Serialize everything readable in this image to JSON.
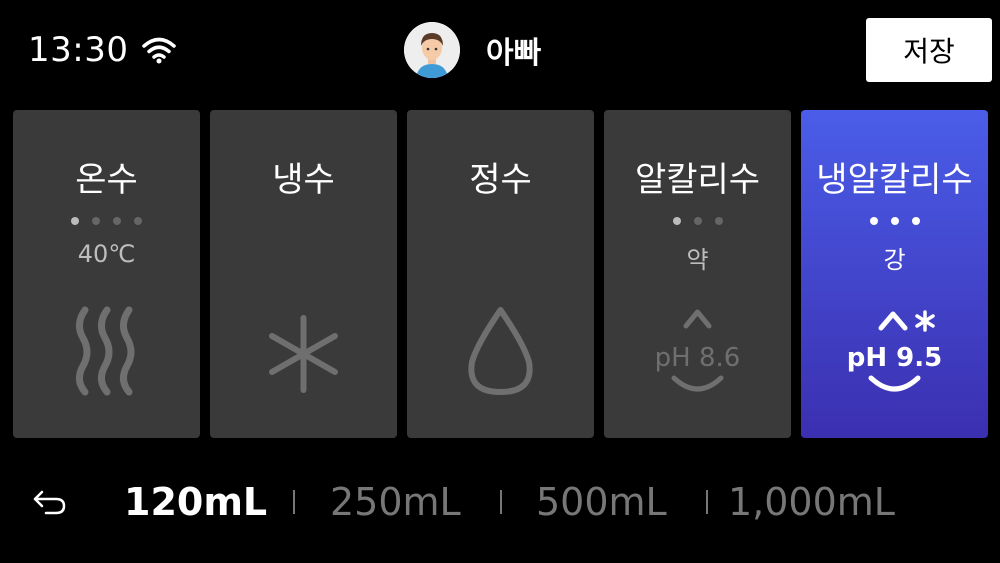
{
  "status": {
    "time": "13:30",
    "wifi_icon": "wifi-icon"
  },
  "profile": {
    "name": "아빠",
    "avatar_icon": "avatar-icon"
  },
  "header": {
    "save_label": "저장"
  },
  "modes": [
    {
      "title": "온수",
      "sub": "40℃",
      "icon": "steam-icon",
      "dots_on": 1,
      "dots_total": 4,
      "active": false
    },
    {
      "title": "냉수",
      "sub": "",
      "icon": "snowflake-icon",
      "dots_on": 0,
      "dots_total": 0,
      "active": false
    },
    {
      "title": "정수",
      "sub": "",
      "icon": "water-drop-icon",
      "dots_on": 0,
      "dots_total": 0,
      "active": false
    },
    {
      "title": "알칼리수",
      "sub": "약",
      "icon": "ph-icon",
      "ph_text": "pH 8.6",
      "dots_on": 1,
      "dots_total": 3,
      "active": false
    },
    {
      "title": "냉알칼리수",
      "sub": "강",
      "icon": "cold-ph-icon",
      "ph_text": "pH 9.5",
      "dots_on": 3,
      "dots_total": 3,
      "active": true
    }
  ],
  "volumes": {
    "options": [
      "120mL",
      "250mL",
      "500mL",
      "1,000mL"
    ],
    "selected": "120mL",
    "back_icon": "back-arrow-icon"
  },
  "colors": {
    "active_top": "#4a5de8",
    "active_bottom": "#3b2fb0",
    "card": "#3a3a3a"
  }
}
